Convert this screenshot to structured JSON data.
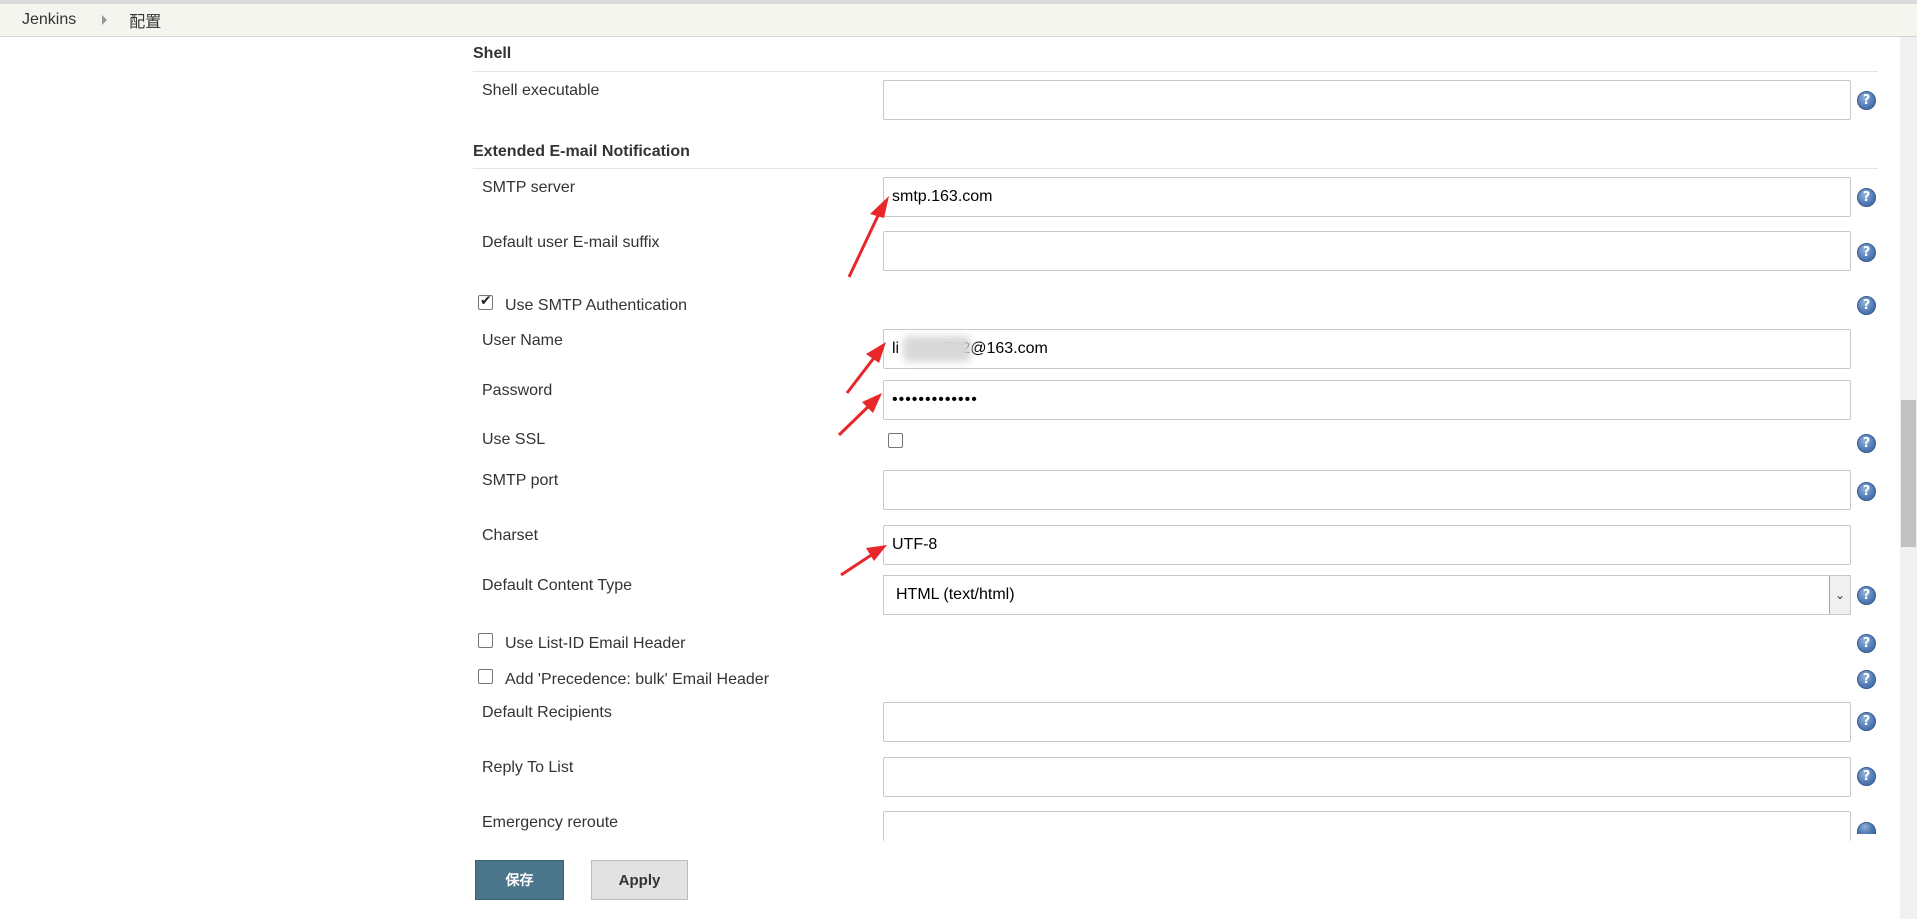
{
  "breadcrumb": {
    "home": "Jenkins",
    "current": "配置"
  },
  "shell": {
    "title": "Shell",
    "executable_label": "Shell executable",
    "executable_value": ""
  },
  "email": {
    "title": "Extended E-mail Notification",
    "smtp_server_label": "SMTP server",
    "smtp_server_value": "smtp.163.com",
    "suffix_label": "Default user E-mail suffix",
    "suffix_value": "",
    "use_auth_label": "Use SMTP Authentication",
    "use_auth_checked": true,
    "username_label": "User Name",
    "username_value": "li          722@163.com",
    "password_label": "Password",
    "password_value": "•••••••••••••",
    "ssl_label": "Use SSL",
    "ssl_checked": false,
    "port_label": "SMTP port",
    "port_value": "",
    "charset_label": "Charset",
    "charset_value": "UTF-8",
    "content_type_label": "Default Content Type",
    "content_type_value": "HTML (text/html)",
    "list_id_label": "Use List-ID Email Header",
    "list_id_checked": false,
    "precedence_label": "Add 'Precedence: bulk' Email Header",
    "precedence_checked": false,
    "recipients_label": "Default Recipients",
    "recipients_value": "",
    "reply_to_label": "Reply To List",
    "reply_to_value": "",
    "reroute_label": "Emergency reroute",
    "reroute_value": ""
  },
  "buttons": {
    "save": "保存",
    "apply": "Apply"
  },
  "icons": {
    "help": "help-icon",
    "separator": "breadcrumb-arrow-icon",
    "dropdown": "chevron-down-icon",
    "annotation": "red-arrow-annotation"
  },
  "colors": {
    "save_button": "#4b758b",
    "help_icon": "#4f78b3",
    "annotation_arrow": "#e8272a"
  }
}
